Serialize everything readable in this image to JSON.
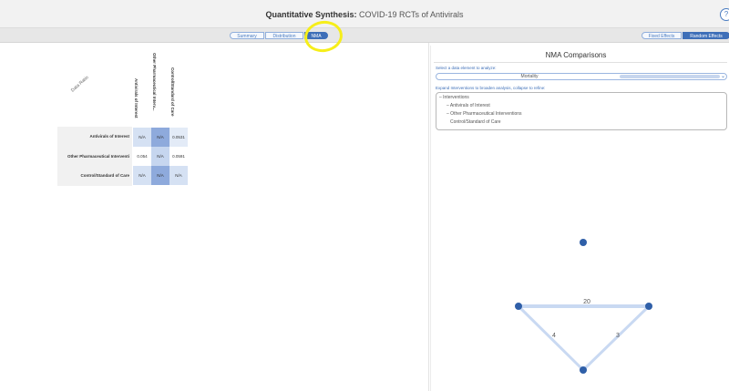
{
  "header": {
    "title_prefix": "Quantitative Synthesis:",
    "title": "COVID-19 RCTs of Antivirals",
    "help_icon": "?"
  },
  "tabs": [
    {
      "label": "Summary"
    },
    {
      "label": "Distribution"
    },
    {
      "label": "NMA"
    }
  ],
  "effects_tabs": [
    {
      "label": "Fixed Effects"
    },
    {
      "label": "Random Effects"
    }
  ],
  "matrix": {
    "corner_label": "Data Ratio",
    "columns": [
      "Antivirals of Interest",
      "Other Pharmaceutical Interv...",
      "Control/Standard of Care"
    ],
    "rows": [
      {
        "label": "Antivirals of Interest",
        "cells": [
          "N/A",
          "N/A",
          "0.0531"
        ]
      },
      {
        "label": "Other Pharmaceutical Interventi",
        "cells": [
          "0.054",
          "N/A",
          "0.0591"
        ]
      },
      {
        "label": "Control/Standard of Care",
        "cells": [
          "N/A",
          "N/A",
          "N/A"
        ]
      }
    ]
  },
  "nma": {
    "title": "NMA Comparisons",
    "select_label": "Select a data element to analyze:",
    "select_value": "Mortality",
    "tree_label": "Expand Interventions to broaden analysis, collapse to refine:",
    "tree": {
      "root": "Interventions",
      "children": [
        "Antivirals of Interest",
        "Other Pharmaceutical Interventions",
        "Control/Standard of Care"
      ]
    },
    "graph": {
      "edge_labels": [
        "20",
        "4",
        "3"
      ]
    }
  },
  "colors": {
    "accent": "#3e6fb8",
    "annotation": "#f6ee1a",
    "cell_light": "#e3ebf7",
    "cell_mid": "#c6d6ef",
    "cell_dark": "#8eaadc",
    "graph_node": "#2f5fa8",
    "graph_edge": "#c9d9f2"
  }
}
